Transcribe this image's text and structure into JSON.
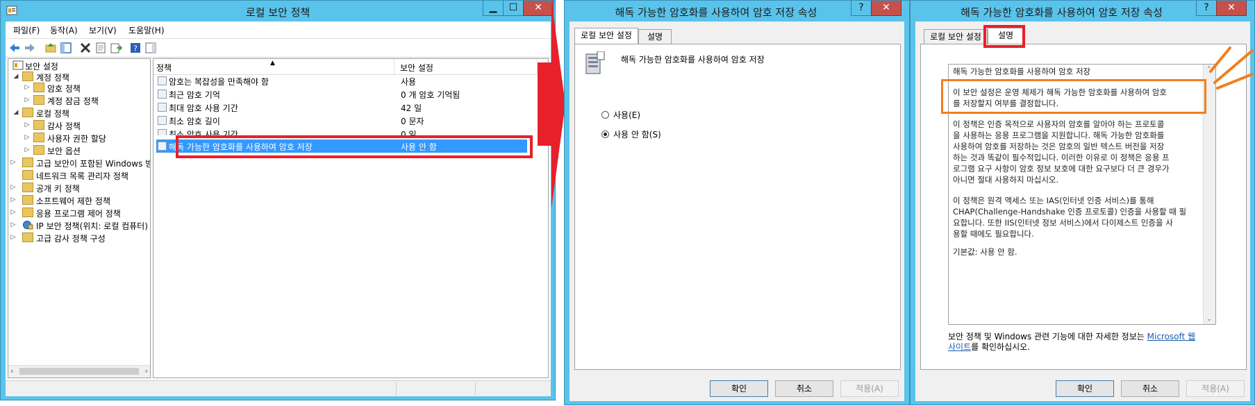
{
  "window1": {
    "title": "로컬 보안 정책",
    "menu": [
      "파일(F)",
      "동작(A)",
      "보기(V)",
      "도움말(H)"
    ],
    "tree": [
      {
        "label": "보안 설정",
        "level": 0,
        "expander": ""
      },
      {
        "label": "계정 정책",
        "level": 1,
        "expander": "◢"
      },
      {
        "label": "암호 정책",
        "level": 2,
        "expander": "▷"
      },
      {
        "label": "계정 잠금 정책",
        "level": 2,
        "expander": "▷"
      },
      {
        "label": "로컬 정책",
        "level": 1,
        "expander": "◢"
      },
      {
        "label": "감사 정책",
        "level": 2,
        "expander": "▷"
      },
      {
        "label": "사용자 권한 할당",
        "level": 2,
        "expander": "▷"
      },
      {
        "label": "보안 옵션",
        "level": 2,
        "expander": "▷"
      },
      {
        "label": "고급 보안이 포함된 Windows 방화벽",
        "level": 1,
        "expander": "▷"
      },
      {
        "label": "네트워크 목록 관리자 정책",
        "level": 1,
        "expander": ""
      },
      {
        "label": "공개 키 정책",
        "level": 1,
        "expander": "▷"
      },
      {
        "label": "소프트웨어 제한 정책",
        "level": 1,
        "expander": "▷"
      },
      {
        "label": "응용 프로그램 제어 정책",
        "level": 1,
        "expander": "▷"
      },
      {
        "label": "IP 보안 정책(위치: 로컬 컴퓨터)",
        "level": 1,
        "expander": "▷"
      },
      {
        "label": "고급 감사 정책 구성",
        "level": 1,
        "expander": "▷"
      }
    ],
    "columns": {
      "policy": "정책",
      "setting": "보안 설정"
    },
    "rows": [
      {
        "policy": "암호는 복잡성을 만족해야 함",
        "setting": "사용"
      },
      {
        "policy": "최근 암호 기억",
        "setting": "0 개 암호 기억됨"
      },
      {
        "policy": "최대 암호 사용 기간",
        "setting": "42 일"
      },
      {
        "policy": "최소 암호 길이",
        "setting": "0 문자"
      },
      {
        "policy": "최소 암호 사용 기간",
        "setting": "0 일"
      },
      {
        "policy": "해독 가능한 암호화를 사용하여 암호 저장",
        "setting": "사용 안 함"
      }
    ]
  },
  "window2": {
    "title": "해독 가능한 암호화를 사용하여 암호 저장 속성",
    "tabs": [
      "로컬 보안 설정",
      "설명"
    ],
    "policy_name": "해독 가능한 암호화를 사용하여 암호 저장",
    "option_enabled": "사용(E)",
    "option_disabled": "사용 안 함(S)",
    "ok": "확인",
    "cancel": "취소",
    "apply": "적용(A)"
  },
  "window3": {
    "title": "해독 가능한 암호화를 사용하여 암호 저장 속성",
    "tabs": [
      "로컬 보안 설정",
      "설명"
    ],
    "desc_title": "해독 가능한 암호화를 사용하여 암호 저장",
    "desc_p1": [
      "이 보안 설정은 운영 체제가 해독 가능한 암호화를 사용하여 암호",
      "를 저장할지 여부를 결정합니다."
    ],
    "desc_p2": [
      "이 정책은 인증 목적으로 사용자의 암호를 알아야 하는 프로토콜",
      "을 사용하는 응용 프로그램을 지원합니다. 해독 가능한 암호화를",
      "사용하여 암호를 저장하는 것은 암호의 일반 텍스트 버전을 저장",
      "하는 것과 똑같이 필수적입니다. 이러한 이유로 이 정책은 응용 프",
      "로그램 요구 사항이 암호 정보 보호에 대한 요구보다 더 큰 경우가",
      "아니면 절대 사용하지 마십시오."
    ],
    "desc_p3": [
      "이 정책은 원격 액세스 또는 IAS(인터넷 인증 서비스)를 통해",
      "CHAP(Challenge-Handshake 인증 프로토콜) 인증을 사용할 때 필",
      "요합니다. 또한 IIS(인터넷 정보 서비스)에서 다이제스트 인증을 사",
      "용할 때에도 필요합니다."
    ],
    "desc_default": "기본값: 사용 안 함.",
    "footer_text1": "보안 정책 및 Windows 관련 기능에 대한 자세한 정보는 ",
    "footer_link1": "Microsoft 웹",
    "footer_link2": "사이트",
    "footer_text2": "를 확인하십시오.",
    "ok": "확인",
    "cancel": "취소",
    "apply": "적용(A)"
  },
  "colors": {
    "accent_red": "#e8202a",
    "accent_orange": "#f07f1e",
    "selection": "#3399ff",
    "titlebar": "#59c3eb"
  }
}
